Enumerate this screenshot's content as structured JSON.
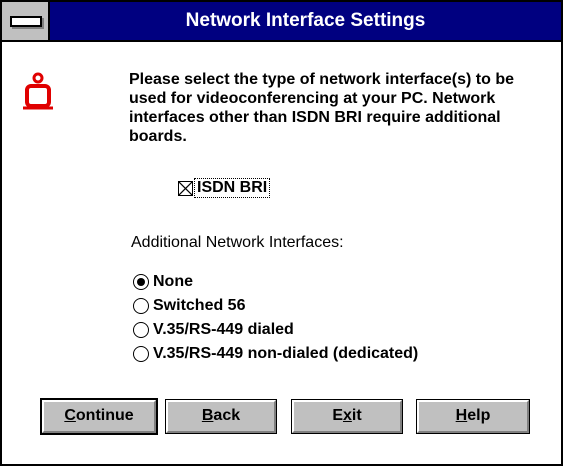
{
  "window": {
    "title": "Network Interface Settings"
  },
  "message": {
    "text": "Please select the type of network interface(s) to be used for videoconferencing at your PC. Network interfaces other than ISDN BRI require additional boards."
  },
  "isdn": {
    "label": "ISDN BRI",
    "checked": true
  },
  "additional": {
    "heading": "Additional Network Interfaces:",
    "options": [
      {
        "label": "None",
        "selected": true
      },
      {
        "label": "Switched 56",
        "selected": false
      },
      {
        "label": "V.35/RS-449 dialed",
        "selected": false
      },
      {
        "label": "V.35/RS-449 non-dialed (dedicated)",
        "selected": false
      }
    ]
  },
  "buttons": {
    "continue": {
      "mnemonic": "C",
      "rest": "ontinue"
    },
    "back": {
      "mnemonic": "B",
      "rest": "ack"
    },
    "exit": {
      "pre": "E",
      "mnemonic": "x",
      "rest": "it"
    },
    "help": {
      "mnemonic": "H",
      "rest": "elp"
    }
  },
  "colors": {
    "titlebar": "#000080",
    "button_face": "#c0c0c0",
    "icon_red": "#e00000"
  },
  "icons": {
    "system_menu": "system-menu-icon",
    "information": "information-icon"
  }
}
